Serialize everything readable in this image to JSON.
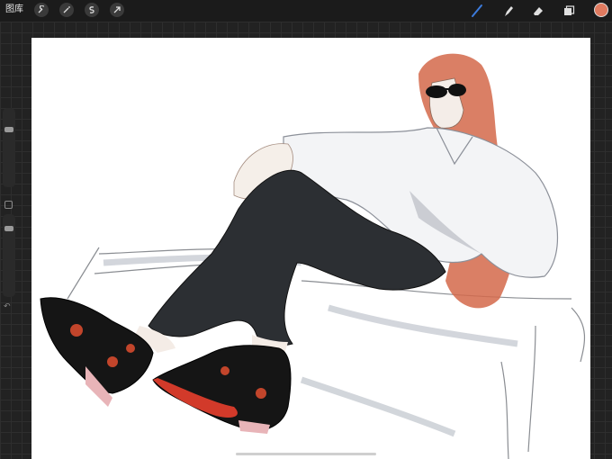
{
  "toolbar": {
    "gallery_label": "图库",
    "left_tools": [
      "wrench-icon",
      "magic-wand-icon",
      "selection-icon",
      "transform-arrow-icon"
    ],
    "right_tools": [
      "brush-icon",
      "smudge-icon",
      "eraser-icon",
      "layers-icon"
    ],
    "active_color": "#e07a5f",
    "brush_color": "#3c7bdc"
  },
  "sidebar": {
    "brush_size_level": 0.25,
    "opacity_level": 0.05
  },
  "palette": {
    "hair": "#d4694a",
    "pants": "#2c2f33",
    "shirt_shadow": "#b9bcc4",
    "shoe": "#151515",
    "sole": "#d23a2a",
    "flower": "#c2452b"
  }
}
